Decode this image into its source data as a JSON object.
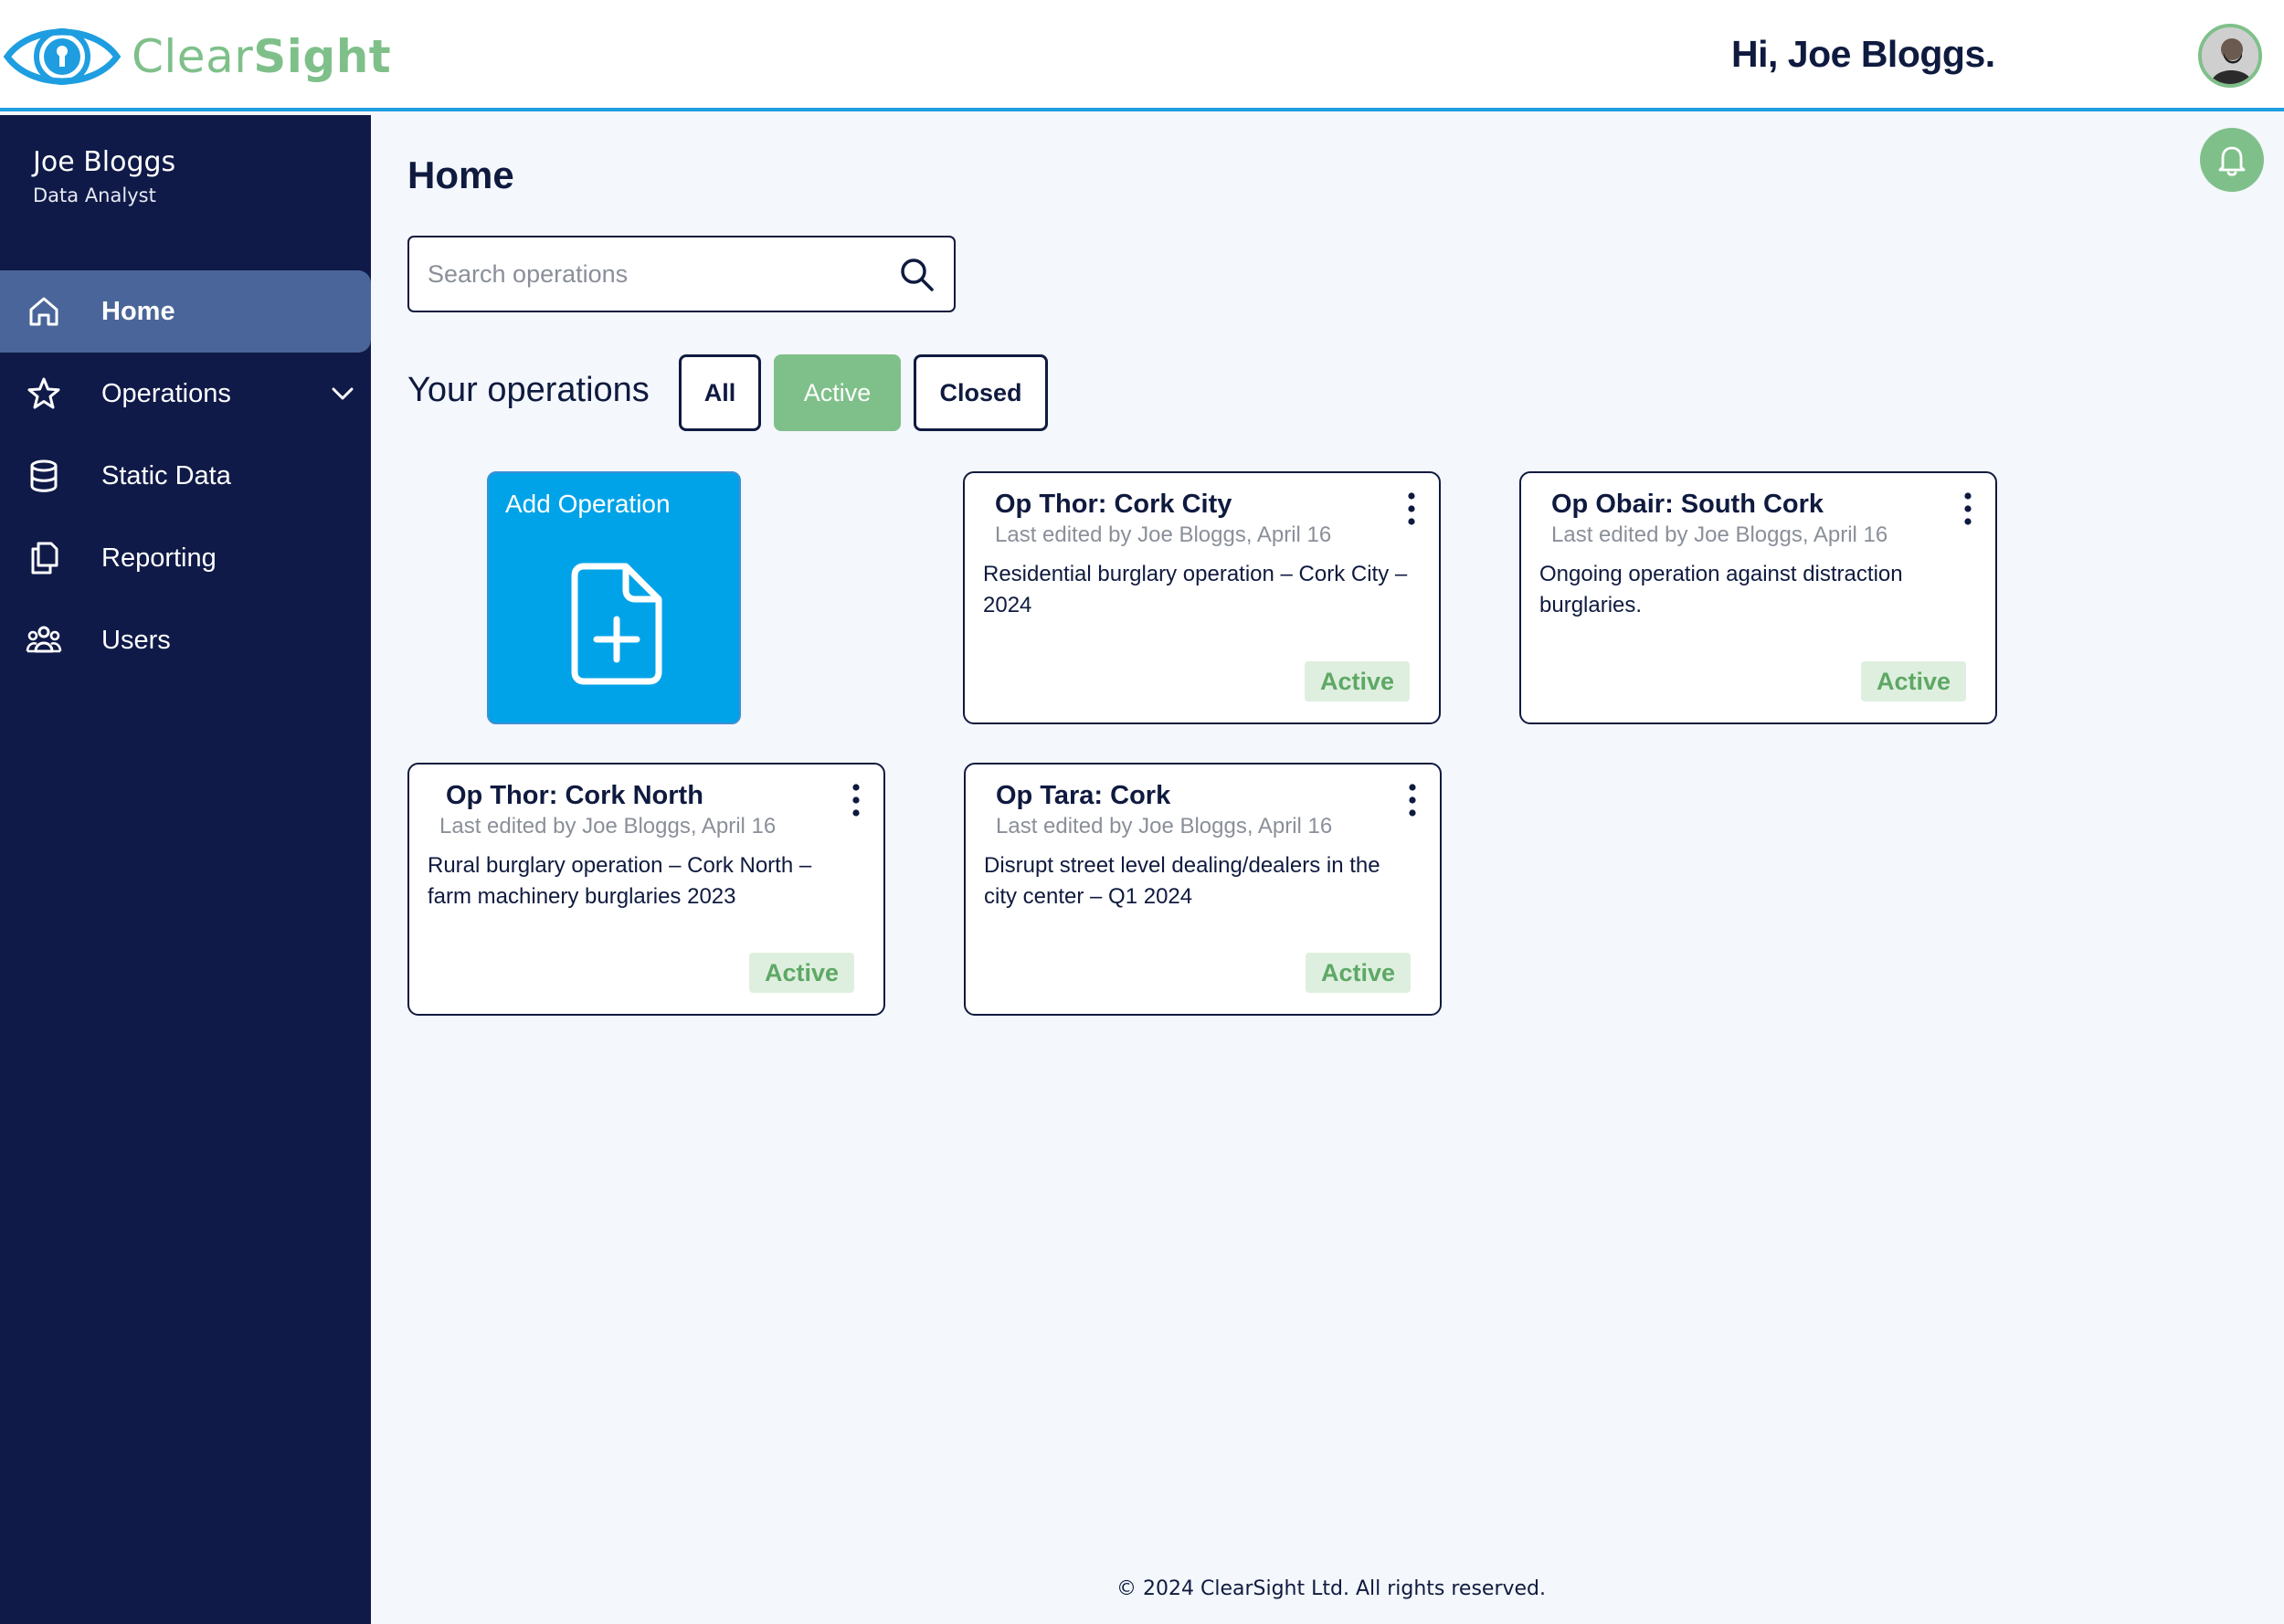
{
  "header": {
    "logo_text_light": "Clear",
    "logo_text_bold": "Sight",
    "greeting": "Hi, Joe Bloggs."
  },
  "user": {
    "name": "Joe Bloggs",
    "role": "Data Analyst"
  },
  "sidebar": {
    "items": [
      {
        "label": "Home",
        "icon": "home-icon",
        "active": true
      },
      {
        "label": "Operations",
        "icon": "star-icon",
        "has_submenu": true
      },
      {
        "label": "Static Data",
        "icon": "database-icon"
      },
      {
        "label": "Reporting",
        "icon": "copy-icon"
      },
      {
        "label": "Users",
        "icon": "users-icon"
      }
    ]
  },
  "main": {
    "title": "Home",
    "search_placeholder": "Search operations",
    "operations_title": "Your operations",
    "filters": [
      {
        "label": "All"
      },
      {
        "label": "Active",
        "selected": true
      },
      {
        "label": "Closed"
      }
    ],
    "add_operation_label": "Add Operation",
    "cards": [
      {
        "title": "Op Thor: Cork City",
        "meta": "Last edited by Joe Bloggs, April 16",
        "description": "Residential burglary operation – Cork City – 2024",
        "status": "Active"
      },
      {
        "title": "Op Obair: South Cork",
        "meta": "Last edited by Joe Bloggs, April 16",
        "description": "Ongoing operation against distraction burglaries.",
        "status": "Active"
      },
      {
        "title": "Op Thor: Cork North",
        "meta": "Last edited by Joe Bloggs, April 16",
        "description": "Rural burglary operation – Cork North – farm machinery burglaries 2023",
        "status": "Active"
      },
      {
        "title": "Op Tara: Cork",
        "meta": "Last edited by Joe Bloggs, April 16",
        "description": "Disrupt street level dealing/dealers in the city center – Q1 2024",
        "status": "Active"
      }
    ]
  },
  "footer": {
    "text": "© 2024 ClearSight Ltd. All rights reserved."
  },
  "colors": {
    "navy": "#0f1a48",
    "accent_blue": "#1e9ee0",
    "green": "#7fc08a",
    "add_card_blue": "#00a3e8",
    "nav_active": "#4a6599"
  }
}
